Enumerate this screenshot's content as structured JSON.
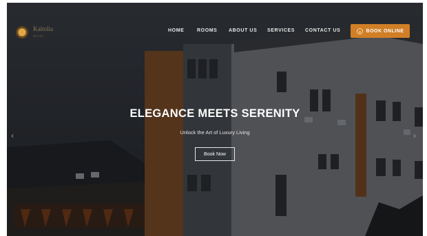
{
  "brand": {
    "name": "Kaitolia",
    "tagline": "HOTEL"
  },
  "nav": {
    "items": [
      {
        "label": "HOME"
      },
      {
        "label": "ROOMS"
      },
      {
        "label": "ABOUT US"
      },
      {
        "label": "SERVICES"
      },
      {
        "label": "CONTACT US"
      }
    ],
    "book_label": "BOOK ONLINE"
  },
  "hero": {
    "title": "ELEGANCE MEETS SERENITY",
    "subtitle": "Unlock the Art of Luxury Living",
    "button_label": "Book Now"
  },
  "carousel": {
    "prev_icon": "chevron-left-icon",
    "next_icon": "chevron-right-icon"
  },
  "colors": {
    "accent": "#d07f26",
    "overlay": "#0a0c10"
  }
}
